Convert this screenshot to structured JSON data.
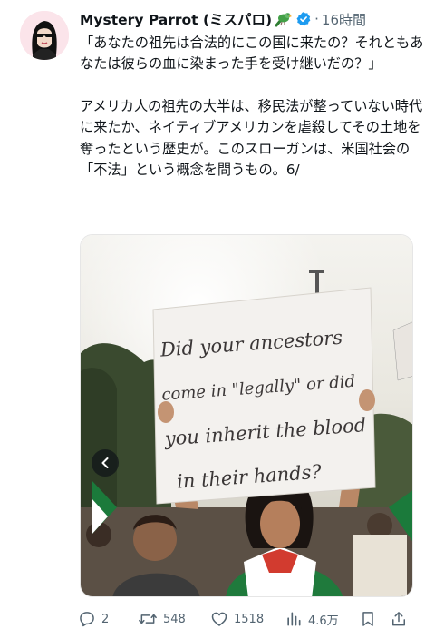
{
  "author": {
    "name": "Mystery Parrot (ミスパロ)",
    "timestamp": "16時間",
    "separator": "·"
  },
  "tweet": {
    "paragraphs": [
      "「あなたの祖先は合法的にこの国に来たの？それともあなたは彼らの血に染まった手を受け継いだの？」",
      "アメリカ人の祖先の大半は、移民法が整っていない時代に来たか、ネイティブアメリカンを虐殺してその土地を奪ったという歴史が。このスローガンは、米国社会の「不法」という概念を問うもの。6/"
    ]
  },
  "media": {
    "sign_lines": [
      "Did your ancestors",
      "come in \"legally\" or did",
      "you inherit the blood",
      "in their hands?"
    ]
  },
  "actions": {
    "reply_count": "2",
    "retweet_count": "548",
    "like_count": "1518",
    "views_count": "4.6万"
  },
  "colors": {
    "text": "#0f1419",
    "secondary": "#536471",
    "verified": "#1d9bf0"
  }
}
